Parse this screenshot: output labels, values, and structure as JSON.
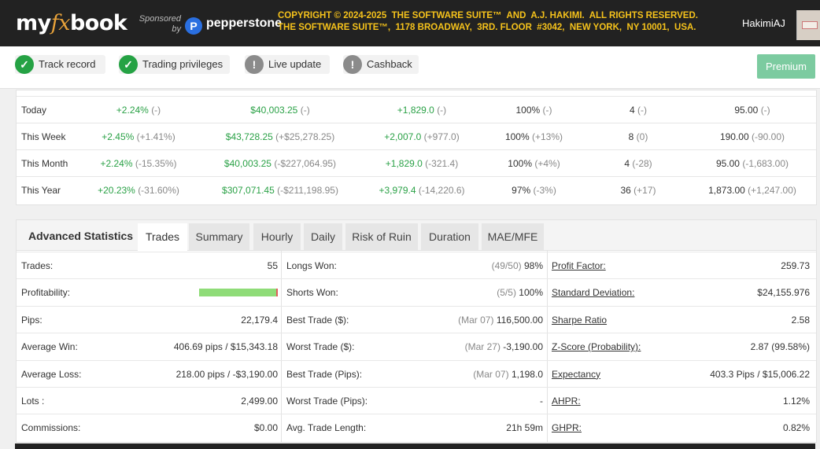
{
  "header": {
    "logo": {
      "my": "my",
      "fx": "fx",
      "book": "book"
    },
    "sponsored_by": "Sponsored by",
    "sponsor_badge": "P",
    "sponsor_name": "pepperstone",
    "copyright_line1": "COPYRIGHT © 2024-2025  THE SOFTWARE SUITE™  AND  A.J. HAKIMI.  ALL RIGHTS RESERVED.",
    "copyright_line2": "THE SOFTWARE SUITE™,  1178 BROADWAY,  3RD. FLOOR  #3042,  NEW YORK,  NY 10001,  USA.",
    "username": "HakimiAJ"
  },
  "status": {
    "items": [
      {
        "label": "Track record",
        "icon": "check-icon",
        "state": "ok"
      },
      {
        "label": "Trading privileges",
        "icon": "check-icon",
        "state": "ok"
      },
      {
        "label": "Live update",
        "icon": "exclamation-icon",
        "state": "warn"
      },
      {
        "label": "Cashback",
        "icon": "exclamation-icon",
        "state": "warn"
      }
    ],
    "premium_label": "Premium"
  },
  "periods": [
    {
      "name": "Today",
      "gain": "+2.24%",
      "gain_diff": "(-)",
      "profit": "$40,003.25",
      "profit_diff": "(-)",
      "pips": "+1,829.0",
      "pips_diff": "(-)",
      "winrate": "100%",
      "winrate_diff": "(-)",
      "trades": "4",
      "trades_diff": "(-)",
      "lots": "95.00",
      "lots_diff": "(-)"
    },
    {
      "name": "This Week",
      "gain": "+2.45%",
      "gain_diff": "(+1.41%)",
      "profit": "$43,728.25",
      "profit_diff": "(+$25,278.25)",
      "pips": "+2,007.0",
      "pips_diff": "(+977.0)",
      "winrate": "100%",
      "winrate_diff": "(+13%)",
      "trades": "8",
      "trades_diff": "(0)",
      "lots": "190.00",
      "lots_diff": "(-90.00)"
    },
    {
      "name": "This Month",
      "gain": "+2.24%",
      "gain_diff": "(-15.35%)",
      "profit": "$40,003.25",
      "profit_diff": "(-$227,064.95)",
      "pips": "+1,829.0",
      "pips_diff": "(-321.4)",
      "winrate": "100%",
      "winrate_diff": "(+4%)",
      "trades": "4",
      "trades_diff": "(-28)",
      "lots": "95.00",
      "lots_diff": "(-1,683.00)"
    },
    {
      "name": "This Year",
      "gain": "+20.23%",
      "gain_diff": "(-31.60%)",
      "profit": "$307,071.45",
      "profit_diff": "(-$211,198.95)",
      "pips": "+3,979.4",
      "pips_diff": "(-14,220.6)",
      "winrate": "97%",
      "winrate_diff": "(-3%)",
      "trades": "36",
      "trades_diff": "(+17)",
      "lots": "1,873.00",
      "lots_diff": "(+1,247.00)"
    }
  ],
  "advanced": {
    "title": "Advanced Statistics",
    "tabs": [
      "Trades",
      "Summary",
      "Hourly",
      "Daily",
      "Risk of Ruin",
      "Duration",
      "MAE/MFE"
    ],
    "active_tab": "Trades",
    "profitability_fraction": 0.98,
    "col1": [
      {
        "label": "Trades:",
        "value": "55"
      },
      {
        "label": "Profitability:",
        "value": ""
      },
      {
        "label": "Pips:",
        "value": "22,179.4"
      },
      {
        "label": "Average Win:",
        "value": "406.69 pips / $15,343.18"
      },
      {
        "label": "Average Loss:",
        "value": "218.00 pips / -$3,190.00"
      },
      {
        "label": "Lots :",
        "value": "2,499.00"
      },
      {
        "label": "Commissions:",
        "value": "$0.00"
      }
    ],
    "col2": [
      {
        "label": "Longs Won:",
        "note": "(49/50)",
        "value": "98%"
      },
      {
        "label": "Shorts Won:",
        "note": "(5/5)",
        "value": "100%"
      },
      {
        "label": "Best Trade ($):",
        "note": "(Mar 07)",
        "value": "116,500.00"
      },
      {
        "label": "Worst Trade ($):",
        "note": "(Mar 27)",
        "value": "-3,190.00"
      },
      {
        "label": "Best Trade (Pips):",
        "note": "(Mar 07)",
        "value": "1,198.0"
      },
      {
        "label": "Worst Trade (Pips):",
        "note": "",
        "value": "-"
      },
      {
        "label": "Avg. Trade Length:",
        "note": "",
        "value": "21h 59m"
      }
    ],
    "col3": [
      {
        "label": "Profit Factor:",
        "value": "259.73"
      },
      {
        "label": "Standard Deviation:",
        "value": "$24,155.976"
      },
      {
        "label": "Sharpe Ratio",
        "value": "2.58"
      },
      {
        "label": "Z-Score (Probability):",
        "value": "2.87 (99.58%)"
      },
      {
        "label": "Expectancy",
        "value": "403.3 Pips / $15,006.22"
      },
      {
        "label": "AHPR:",
        "value": "1.12%"
      },
      {
        "label": "GHPR:",
        "value": "0.82%"
      }
    ]
  }
}
